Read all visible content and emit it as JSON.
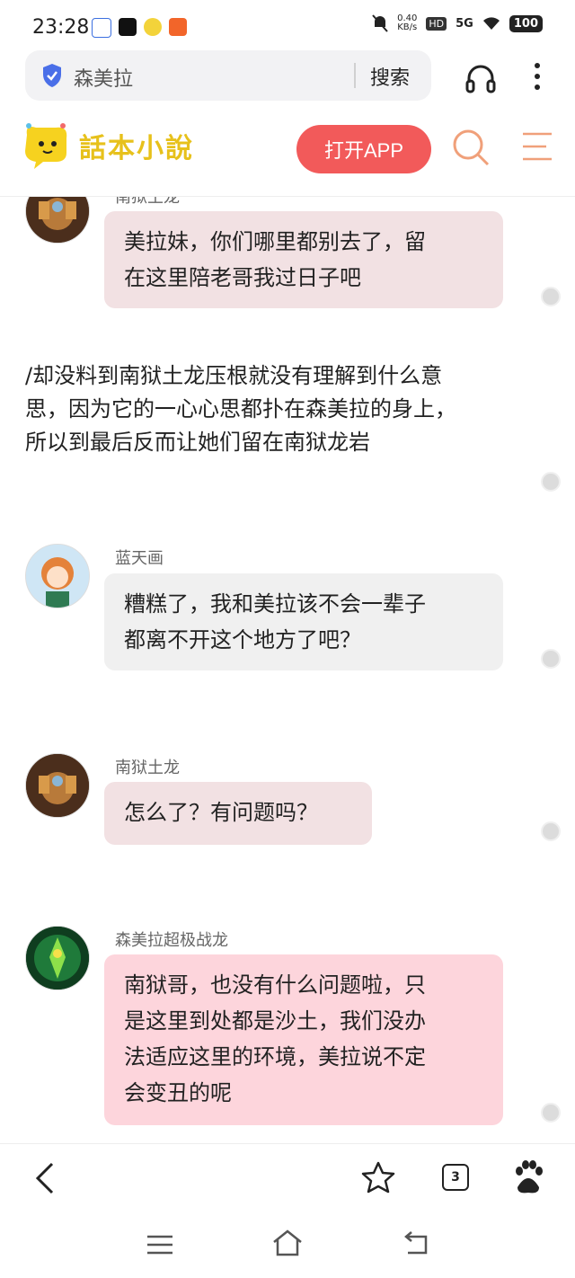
{
  "status_bar": {
    "time": "23:28",
    "net_speed_value": "0.40",
    "net_speed_unit": "KB/s",
    "hd_label": "HD",
    "network_label": "5G",
    "battery": "100"
  },
  "address_bar": {
    "query": "森美拉",
    "search_label": "搜索"
  },
  "site_header": {
    "logo_text": "話本小說",
    "open_app_label": "打开APP"
  },
  "chat": [
    {
      "speaker": "南狱土龙",
      "text_line1": "美拉妹，你们哪里都别去了，留",
      "text_line2": "在这里陪老哥我过日子吧"
    },
    {
      "narration_line1": "/却没料到南狱土龙压根就没有理解到什么意",
      "narration_line2": "思，因为它的一心心思都扑在森美拉的身上，",
      "narration_line3": "所以到最后反而让她们留在南狱龙岩"
    },
    {
      "speaker": "蓝天画",
      "text_line1": "糟糕了，我和美拉该不会一辈子",
      "text_line2": "都离不开这个地方了吧？"
    },
    {
      "speaker": "南狱土龙",
      "text_line1": "怎么了？有问题吗？"
    },
    {
      "speaker": "森美拉超极战龙",
      "text_line1": "南狱哥，也没有什么问题啦，只",
      "text_line2": "是这里到处都是沙土，我们没办",
      "text_line3": "法适应这里的环境，美拉说不定",
      "text_line4": "会变丑的呢"
    }
  ],
  "bottom_nav": {
    "tab_count": "3"
  },
  "colors": {
    "accent_red": "#f25a5a",
    "logo_yellow": "#e7c11b",
    "icon_orange": "#f0a07a",
    "bubble_pinkish": "#f2e1e3",
    "bubble_gray": "#f0f0f0",
    "bubble_pink": "#fdd5dc"
  },
  "icons": [
    "shield-icon",
    "headphones-icon",
    "more-vertical-icon",
    "search-icon",
    "menu-icon",
    "back-icon",
    "star-icon",
    "tabs-icon",
    "baidu-paw-icon",
    "recent-apps-icon",
    "home-icon",
    "system-back-icon"
  ]
}
